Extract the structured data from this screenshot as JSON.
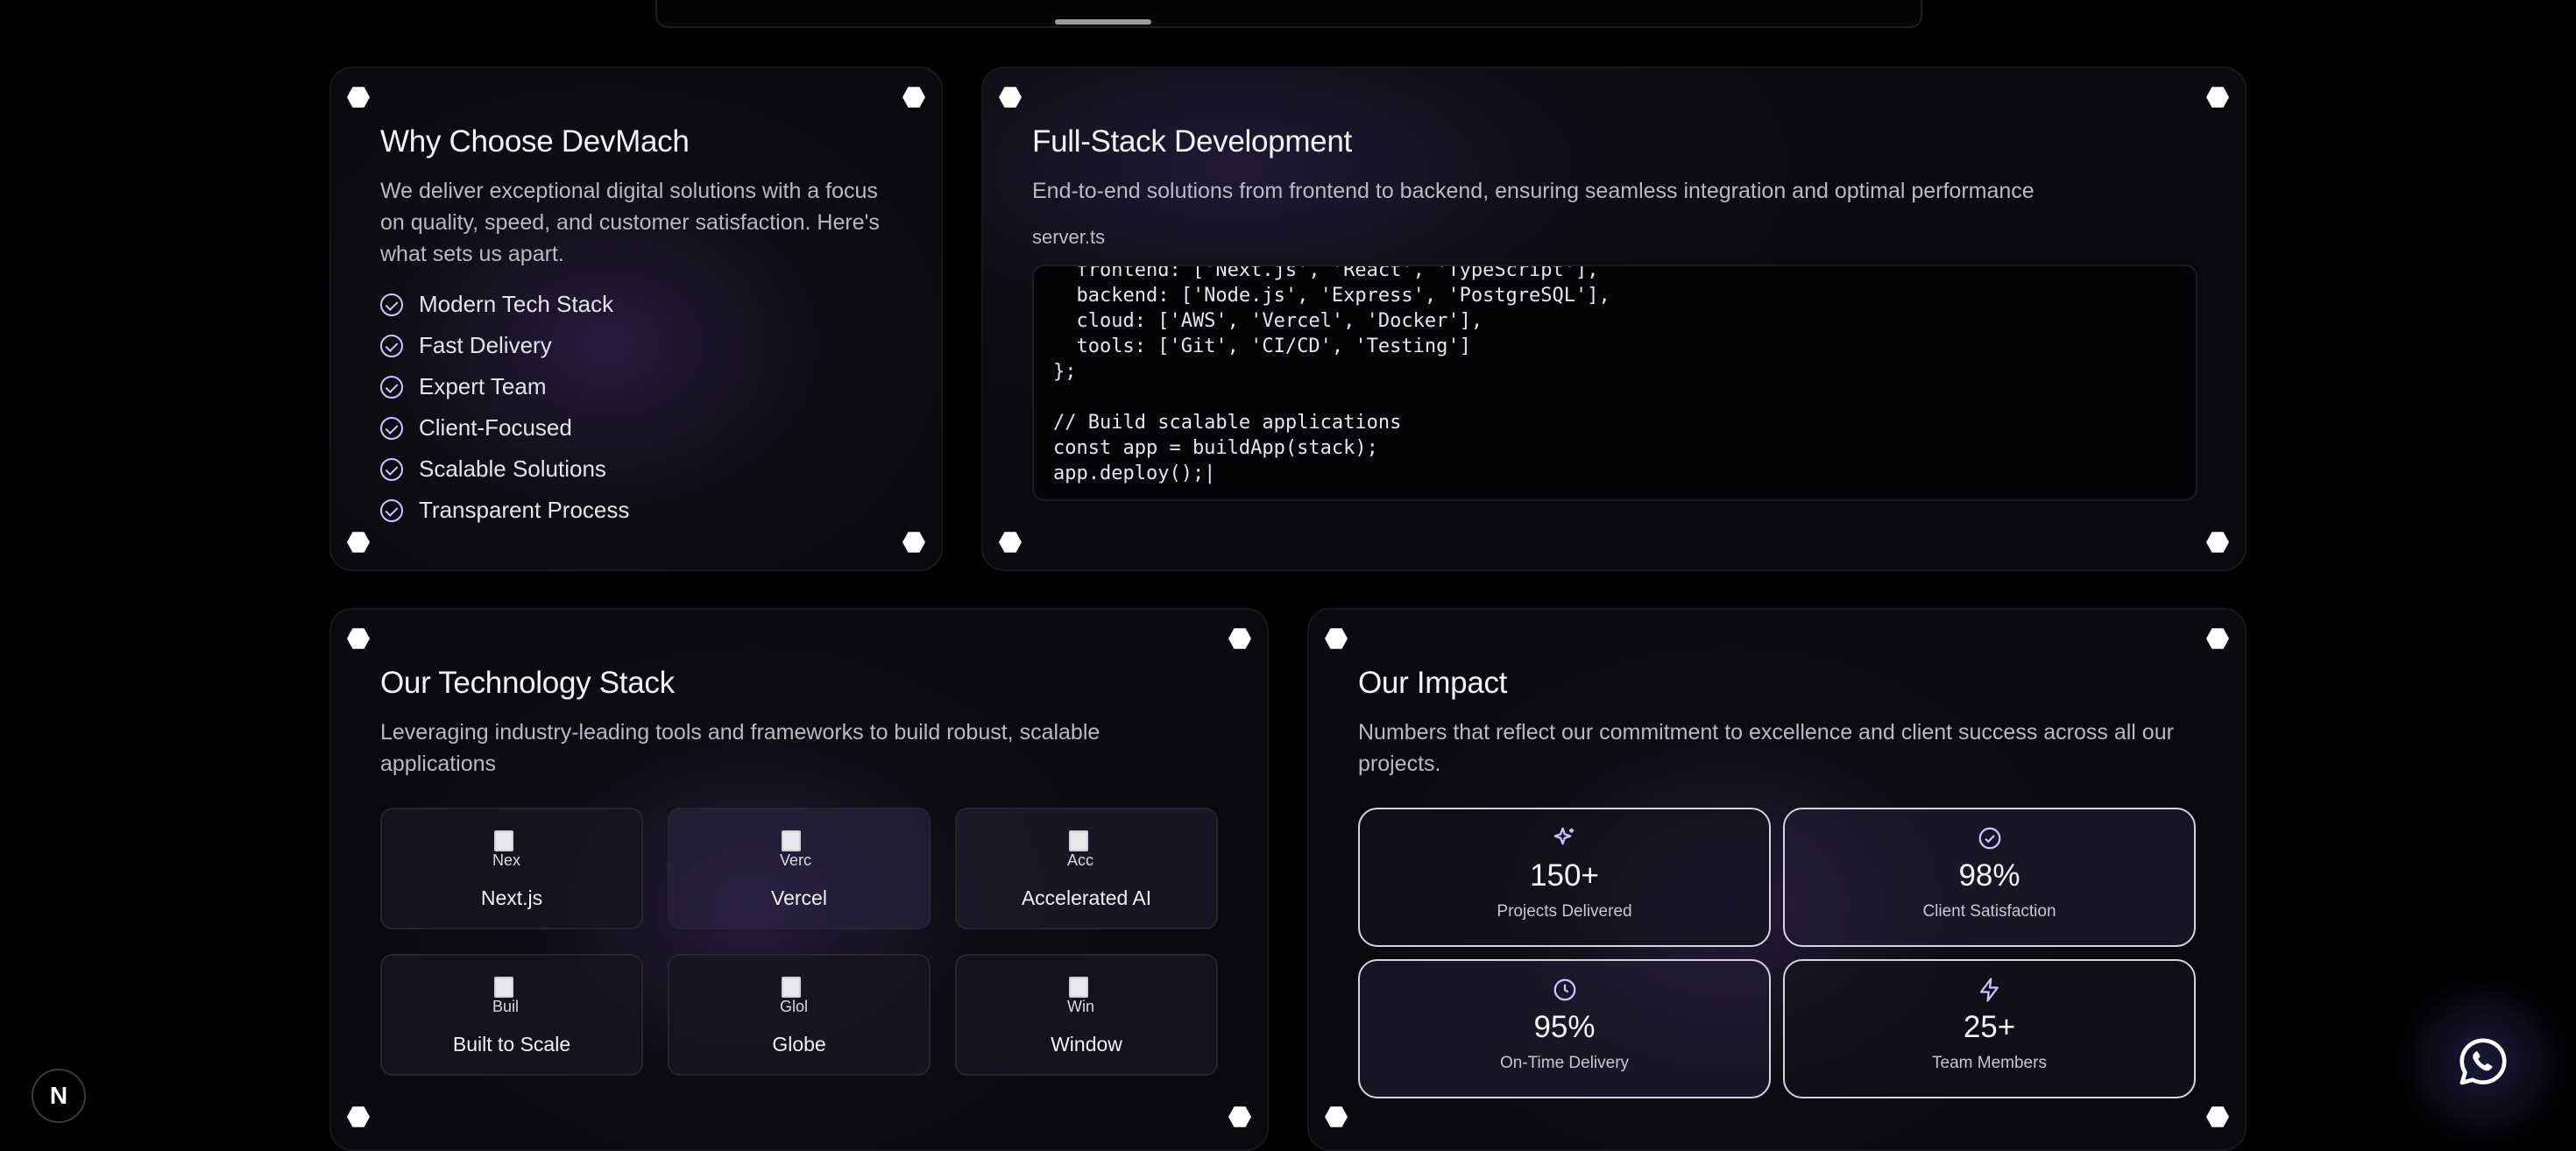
{
  "why": {
    "title": "Why Choose DevMach",
    "description": "We deliver exceptional digital solutions with a focus on quality, speed, and customer satisfaction. Here's what sets us apart.",
    "features": [
      "Modern Tech Stack",
      "Fast Delivery",
      "Expert Team",
      "Client-Focused",
      "Scalable Solutions",
      "Transparent Process"
    ]
  },
  "fullstack": {
    "title": "Full-Stack Development",
    "description": "End-to-end solutions from frontend to backend, ensuring seamless integration and optimal performance",
    "file_name": "server.ts",
    "code": "  frontend: ['Next.js', 'React', 'TypeScript'],\n  backend: ['Node.js', 'Express', 'PostgreSQL'],\n  cloud: ['AWS', 'Vercel', 'Docker'],\n  tools: ['Git', 'CI/CD', 'Testing']\n};\n\n// Build scalable applications\nconst app = buildApp(stack);\napp.deploy();|"
  },
  "tech": {
    "title": "Our Technology Stack",
    "description": "Leveraging industry-leading tools and frameworks to build robust, scalable applications",
    "items": [
      {
        "name": "Next.js",
        "alt": "Nex"
      },
      {
        "name": "Vercel",
        "alt": "Verc"
      },
      {
        "name": "Accelerated AI",
        "alt": "Acc"
      },
      {
        "name": "Built to Scale",
        "alt": "Buil"
      },
      {
        "name": "Globe",
        "alt": "Glol"
      },
      {
        "name": "Window",
        "alt": "Win"
      }
    ]
  },
  "impact": {
    "title": "Our Impact",
    "description": "Numbers that reflect our commitment to excellence and client success across all our projects.",
    "stats": [
      {
        "value": "150+",
        "label": "Projects Delivered",
        "icon": "sparkles-icon"
      },
      {
        "value": "98%",
        "label": "Client Satisfaction",
        "icon": "check-circle-icon"
      },
      {
        "value": "95%",
        "label": "On-Time Delivery",
        "icon": "clock-icon"
      },
      {
        "value": "25+",
        "label": "Team Members",
        "icon": "lightning-icon"
      }
    ]
  },
  "badge": {
    "letter": "N"
  },
  "colors": {
    "accent": "#cfc4ff",
    "background": "#000000",
    "card_glow": "#3a2864"
  }
}
